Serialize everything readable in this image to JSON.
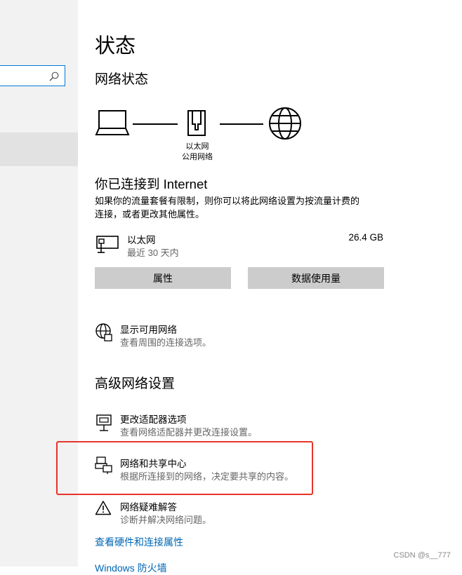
{
  "page": {
    "title": "状态"
  },
  "status": {
    "section_title": "网络状态",
    "network_label_line1": "以太网",
    "network_label_line2": "公用网络"
  },
  "connection": {
    "title": "你已连接到 Internet",
    "description_line1": "如果你的流量套餐有限制，则你可以将此网络设置为按流量计费的",
    "description_line2": "连接，或者更改其他属性。",
    "adapter_name": "以太网",
    "adapter_period": "最近 30 天内",
    "data_usage": "26.4 GB"
  },
  "buttons": {
    "properties": "属性",
    "data_usage": "数据使用量"
  },
  "show_networks": {
    "title": "显示可用网络",
    "desc": "查看周围的连接选项。"
  },
  "advanced": {
    "section_title": "高级网络设置",
    "items": [
      {
        "title": "更改适配器选项",
        "desc": "查看网络适配器并更改连接设置。"
      },
      {
        "title": "网络和共享中心",
        "desc": "根据所连接到的网络，决定要共享的内容。"
      },
      {
        "title": "网络疑难解答",
        "desc": "诊断并解决网络问题。"
      }
    ],
    "links": [
      "查看硬件和连接属性",
      "Windows 防火墙"
    ]
  },
  "watermark": "CSDN @s__777",
  "colors": {
    "link": "#0066b4",
    "highlight": "#e8332b",
    "accent": "#0078d7"
  }
}
